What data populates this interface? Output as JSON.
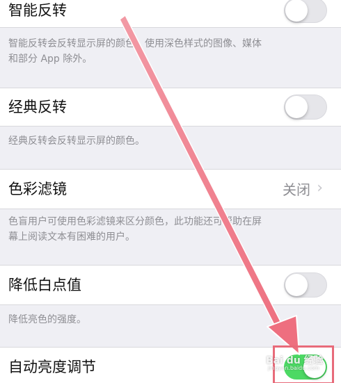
{
  "settings": {
    "smart_invert": {
      "label": "智能反转",
      "on": false,
      "footer_line1": "智能反转会反转显示屏的颜色，使用深色样式的图像、媒体",
      "footer_line2": "和部分 App 除外。"
    },
    "classic_invert": {
      "label": "经典反转",
      "on": false,
      "footer": "经典反转会反转显示屏的颜色。"
    },
    "color_filters": {
      "label": "色彩滤镜",
      "value": "关闭",
      "chevron": "›",
      "footer_line1": "色盲用户可使用色彩滤镜来区分颜色，此功能还可帮助在屏",
      "footer_line2": "幕上阅读文本有困难的用户。"
    },
    "reduce_white_point": {
      "label": "降低白点值",
      "on": false,
      "footer": "降低亮色的强度。"
    },
    "auto_brightness": {
      "label": "自动亮度调节",
      "on": true
    }
  },
  "annotation": {
    "arrow_color": "#f07a87",
    "box_color": "#e86b7a",
    "watermark": "Bai du 经验",
    "watermark_sub": "jingyan.baidu.com"
  },
  "colors": {
    "background": "#efeff4",
    "toggle_on": "#4cd964",
    "secondary_text": "#8e8e93"
  }
}
